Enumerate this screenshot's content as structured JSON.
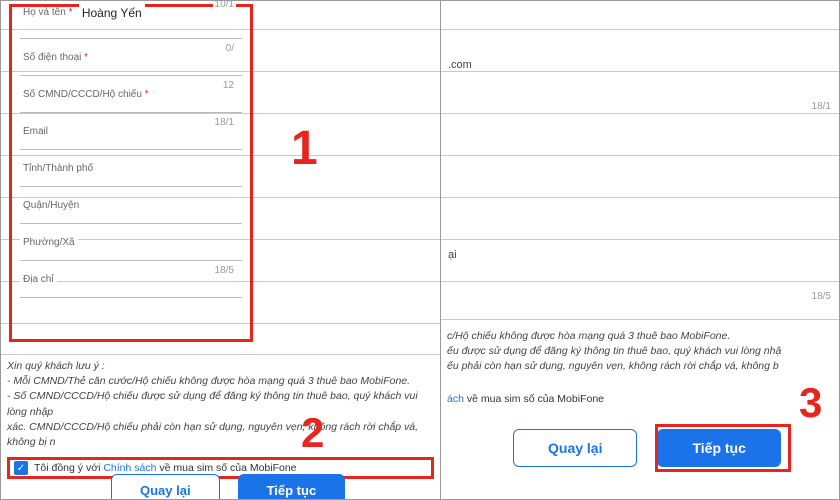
{
  "leftPanel": {
    "fields": {
      "name": {
        "label": "Họ và tên",
        "required": true,
        "value": "Hoàng Yến",
        "counter": "10/1"
      },
      "phone": {
        "label": "Số điện thoại",
        "required": true,
        "counter": "0/"
      },
      "idcard": {
        "label": "Số CMND/CCCD/Hộ chiếu",
        "required": true,
        "counter": "12"
      },
      "email": {
        "label": "Email",
        "counter": "18/1"
      },
      "province": {
        "label": "Tỉnh/Thành phố"
      },
      "district": {
        "label": "Quận/Huyện"
      },
      "ward": {
        "label": "Phường/Xã"
      },
      "address": {
        "label": "Địa chỉ",
        "counter": "18/5"
      }
    },
    "noteTitle": "Xin quý khách lưu ý :",
    "noteLine1": "- Mỗi CMND/Thẻ căn cước/Hộ chiếu không được hòa mạng quá 3 thuê bao MobiFone.",
    "noteLine2a": "- Số CMND/CCCD/Hộ chiếu được sử dụng để đăng ký thông tin thuê bao, quý khách vui lòng nhập",
    "noteLine2b": "xác. CMND/CCCD/Hộ chiếu phải còn hạn sử dụng, nguyên vẹn, không rách rời chắp vá, không bị n",
    "consentPrefix": "Tôi đồng ý với ",
    "consentLink": "Chính sách",
    "consentSuffix": " về mua sim số của MobiFone",
    "btnBack": "Quay lại",
    "btnNext": "Tiếp tục",
    "badge1": "1",
    "badge2": "2"
  },
  "rightPanel": {
    "frag_com": ".com",
    "frag_ai": "ại",
    "counters": {
      "c1": "18/1",
      "c2": "18/5"
    },
    "noteLine1": "c/Hộ chiếu không được hòa mạng quá 3 thuê bao MobiFone.",
    "noteLine2": "ếu được sử dụng để đăng ký thông tin thuê bao, quý khách vui lòng nhậ",
    "noteLine3a": "ếu phải còn hạn sử dụng, nguyên vẹn, không rách rời chắp vá, không b",
    "consentLink": "ách",
    "consentSuffix": " về mua sim số của MobiFone",
    "btnBack": "Quay lại",
    "btnNext": "Tiếp tục",
    "badge3": "3"
  }
}
